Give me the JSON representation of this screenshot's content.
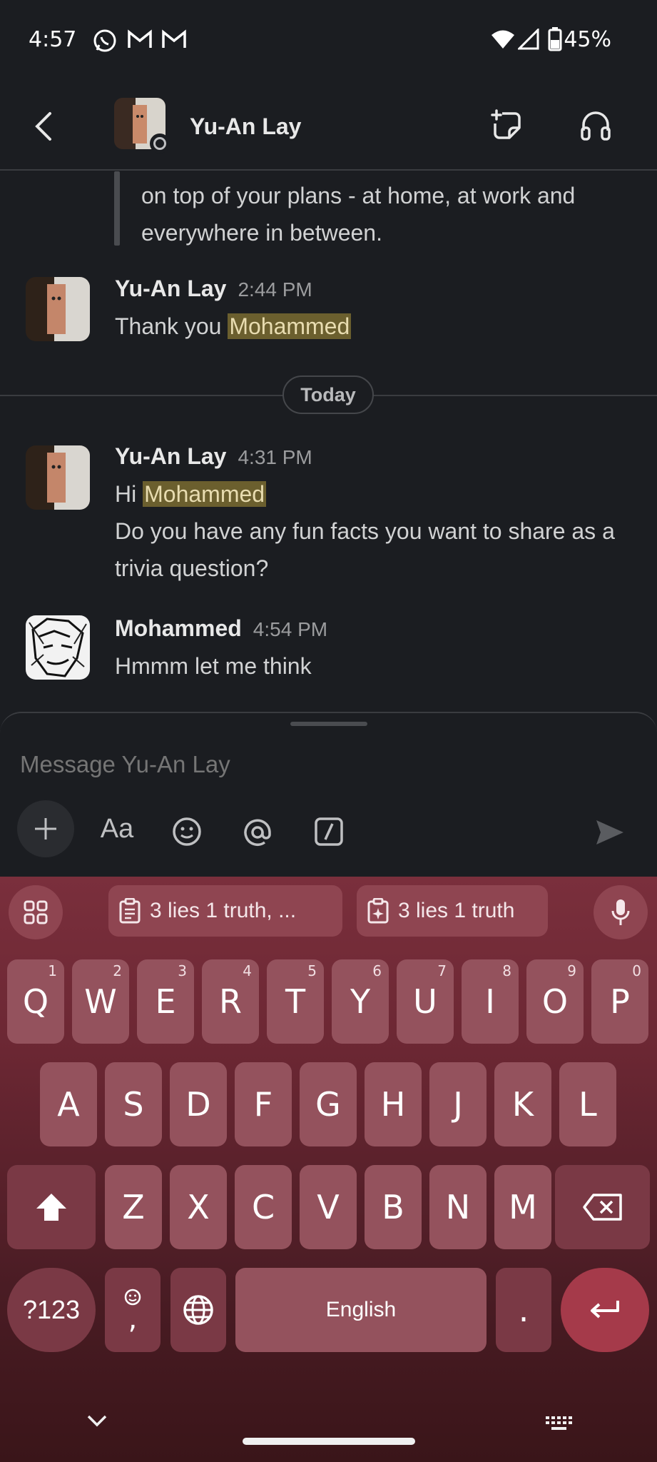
{
  "status_bar": {
    "time": "4:57",
    "battery": "45%",
    "notification_icons": [
      "whatsapp-icon",
      "gmail-icon",
      "gmail-icon"
    ]
  },
  "header": {
    "contact_name": "Yu-An Lay"
  },
  "messages": {
    "quoted_text": "on top of your plans - at home, at work and everywhere in between.",
    "day_divider": "Today",
    "items": [
      {
        "sender": "Yu-An Lay",
        "time": "2:44 PM",
        "lines": [
          "Thank you ",
          "Mohammed"
        ]
      },
      {
        "sender": "Yu-An Lay",
        "time": "4:31 PM",
        "greeting": "Hi ",
        "mention": "Mohammed",
        "body": "Do you have any fun facts you want to share as a trivia question?"
      },
      {
        "sender": "Mohammed",
        "time": "4:54 PM",
        "body": "Hmmm let me think"
      }
    ]
  },
  "composer": {
    "placeholder": "Message Yu-An Lay",
    "format_label": "Aa"
  },
  "keyboard": {
    "suggestions": [
      "3 lies 1 truth, ...",
      "3 lies 1 truth"
    ],
    "row1": [
      {
        "k": "Q",
        "h": "1"
      },
      {
        "k": "W",
        "h": "2"
      },
      {
        "k": "E",
        "h": "3"
      },
      {
        "k": "R",
        "h": "4"
      },
      {
        "k": "T",
        "h": "5"
      },
      {
        "k": "Y",
        "h": "6"
      },
      {
        "k": "U",
        "h": "7"
      },
      {
        "k": "I",
        "h": "8"
      },
      {
        "k": "O",
        "h": "9"
      },
      {
        "k": "P",
        "h": "0"
      }
    ],
    "row2": [
      "A",
      "S",
      "D",
      "F",
      "G",
      "H",
      "J",
      "K",
      "L"
    ],
    "row3": [
      "Z",
      "X",
      "C",
      "V",
      "B",
      "N",
      "M"
    ],
    "symbols_label": "?123",
    "comma_label": ",",
    "space_label": "English",
    "period_label": "."
  }
}
